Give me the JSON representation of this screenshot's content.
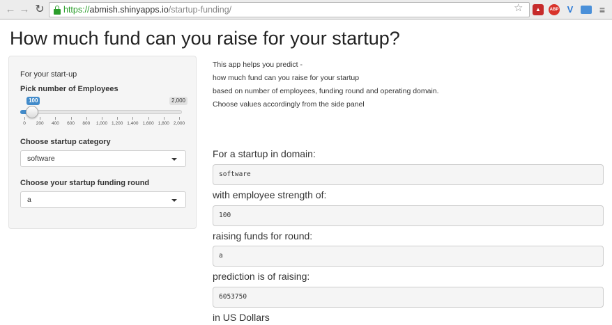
{
  "browser": {
    "url_scheme": "https://",
    "url_host": "abmish.shinyapps.io",
    "url_path": "/startup-funding/",
    "extensions": [
      "ext-red-icon",
      "abp-icon",
      "vimium-icon",
      "folder-icon",
      "menu-icon"
    ],
    "abp_label": "ABP"
  },
  "page": {
    "title": "How much fund can you raise for your startup?"
  },
  "sidebar": {
    "intro": "For your start-up",
    "employees_label": "Pick number of Employees",
    "slider": {
      "value": 100,
      "value_label": "100",
      "min": 0,
      "max": 2000,
      "max_label": "2,000",
      "ticks": [
        "0",
        "200",
        "400",
        "600",
        "800",
        "1,000",
        "1,200",
        "1,400",
        "1,600",
        "1,800",
        "2,000"
      ]
    },
    "category_label": "Choose startup category",
    "category_value": "software",
    "round_label": "Choose your startup funding round",
    "round_value": "a"
  },
  "main": {
    "description": [
      "This app helps you predict -",
      "how much fund can you raise for your startup",
      "based on number of employees, funding round and operating domain.",
      "Choose values accordingly from the side panel"
    ],
    "outputs": {
      "domain_label": "For a startup in domain:",
      "domain_value": "software",
      "employees_label": "with employee strength of:",
      "employees_value": "100",
      "round_label": "raising funds for round:",
      "round_value": "a",
      "prediction_label": "prediction is of raising:",
      "prediction_value": "6053750",
      "currency_label": "in US Dollars"
    }
  },
  "colors": {
    "accent": "#428bca",
    "secure": "#2a9d2a"
  }
}
